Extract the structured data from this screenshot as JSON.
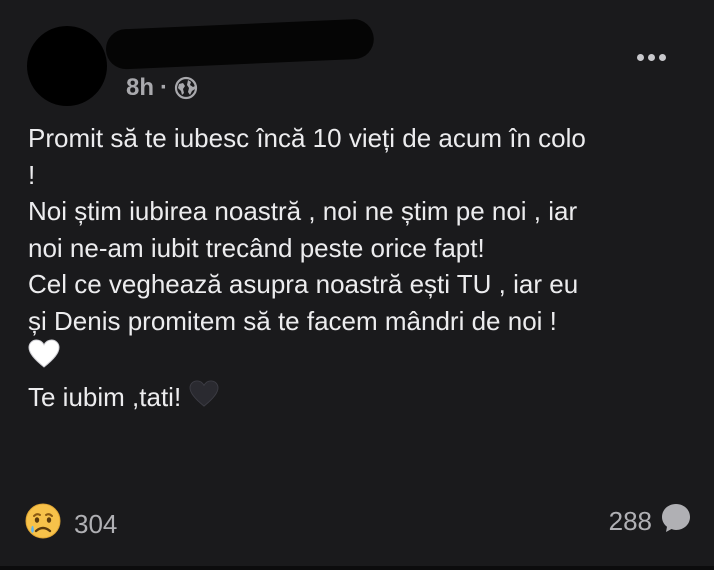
{
  "post": {
    "time": "8h",
    "separator": "·",
    "text_lines": [
      "Promit să te iubesc încă 10 vieți de acum în colo",
      "!",
      "Noi știm iubirea noastră , noi ne știm pe noi , iar",
      "noi ne-am iubit trecând peste orice fapt!",
      "Cel ce veghează asupra noastră ești TU , iar eu",
      "și Denis promitem să te facem mândri de noi !"
    ],
    "last_line": "Te iubim ,tati!",
    "heart_white_icon": "white-heart-emoji",
    "heart_black_icon": "black-heart-emoji"
  },
  "footer": {
    "reaction_icon": "sad-tear-emoji",
    "reaction_count": "304",
    "comment_count": "288",
    "comment_icon": "comment-bubble-icon"
  }
}
